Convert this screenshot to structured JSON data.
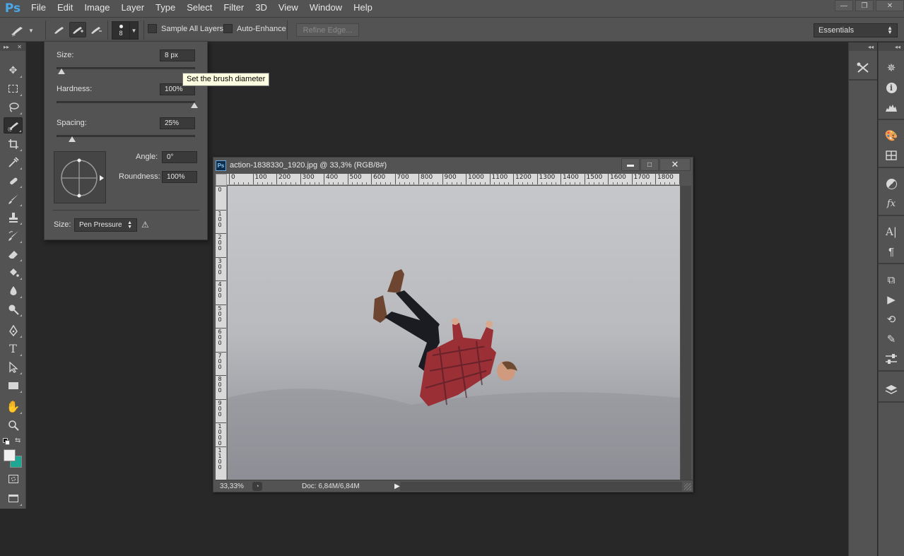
{
  "app": {
    "logo": "Ps"
  },
  "menu": [
    "File",
    "Edit",
    "Image",
    "Layer",
    "Type",
    "Select",
    "Filter",
    "3D",
    "View",
    "Window",
    "Help"
  ],
  "window_controls": {
    "minimize": "—",
    "restore": "❐",
    "close": "✕"
  },
  "options": {
    "brush_size": "8",
    "sample_all_layers": "Sample All Layers",
    "auto_enhance": "Auto-Enhance",
    "refine_edge": "Refine Edge...",
    "workspace": "Essentials"
  },
  "brush_popup": {
    "size_label": "Size:",
    "size_value": "8 px",
    "size_fraction": 0.03,
    "hardness_label": "Hardness:",
    "hardness_value": "100%",
    "hardness_fraction": 1.0,
    "spacing_label": "Spacing:",
    "spacing_value": "25%",
    "spacing_fraction": 0.11,
    "angle_label": "Angle:",
    "angle_value": "0°",
    "roundness_label": "Roundness:",
    "roundness_value": "100%",
    "pressure_label": "Size:",
    "pressure_value": "Pen Pressure"
  },
  "tooltip": "Set the brush diameter",
  "document": {
    "badge": "Ps",
    "title": "action-1838330_1920.jpg @ 33,3% (RGB/8#)",
    "zoom": "33,33%",
    "doc_info": "Doc: 6,84M/6,84M",
    "ruler_top": [
      "0",
      "100",
      "200",
      "300",
      "400",
      "500",
      "600",
      "700",
      "800",
      "900",
      "1000",
      "1100",
      "1200",
      "1300",
      "1400",
      "1500",
      "1600",
      "1700",
      "1800",
      "1"
    ],
    "ruler_left": [
      "0",
      "1\n0\n0",
      "2\n0\n0",
      "3\n0\n0",
      "4\n0\n0",
      "5\n0\n0",
      "6\n0\n0",
      "7\n0\n0",
      "8\n0\n0",
      "9\n0\n0",
      "1\n0\n0\n0",
      "1\n1\n0\n0"
    ]
  },
  "colors": {
    "accent_logo": "#4aa7e8",
    "foreground": "#f0f0f0",
    "background": "#1ea893",
    "tooltip_bg": "#ffffe1"
  }
}
